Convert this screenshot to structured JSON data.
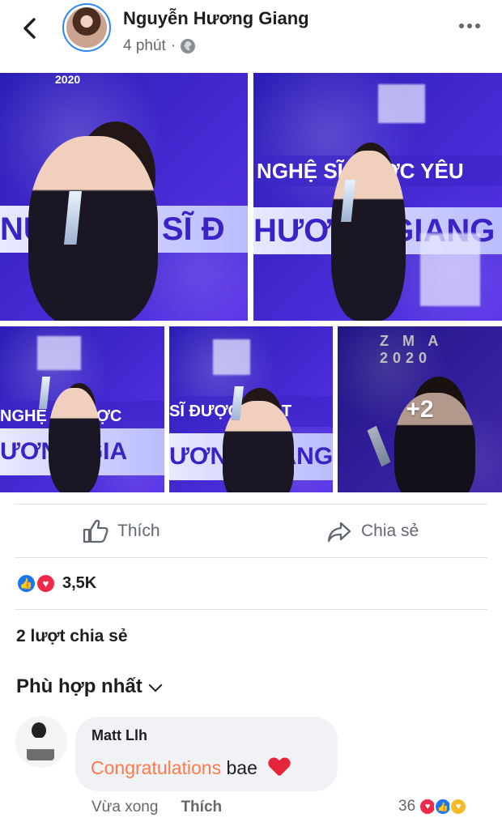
{
  "header": {
    "name": "Nguyễn Hương Giang",
    "time": "4 phút",
    "separator": "·"
  },
  "gallery": {
    "photos": [
      {
        "band_text": "NỮ NGHỆ SĨ Đ",
        "sub_text": "2020"
      },
      {
        "band_text": "HƯƠNG GIANG",
        "sub_text": "NGHỆ SĨ ĐƯỢC YÊU"
      },
      {
        "band_text": "ƯƠNG GIA",
        "sub_text": "NGHỆ SĨ ĐƯỢC"
      },
      {
        "band_text": "ƯƠNG GIANG",
        "sub_text": "SĨ ĐƯỢC YÊU T"
      },
      {
        "band_text": "",
        "sub_text": "Z M A 2020"
      }
    ],
    "more_count": "+2"
  },
  "actions": {
    "like": "Thích",
    "share": "Chia sẻ"
  },
  "reactions": {
    "count": "3,5K",
    "colors": {
      "like": "#1877f2",
      "love": "#f02849"
    }
  },
  "shares": "2 lượt chia sẻ",
  "sort": "Phù hợp nhất",
  "comment": {
    "author": "Matt Llh",
    "highlight": "Congratulations",
    "rest": "bae",
    "time": "Vừa xong",
    "like": "Thích",
    "count": "36"
  }
}
